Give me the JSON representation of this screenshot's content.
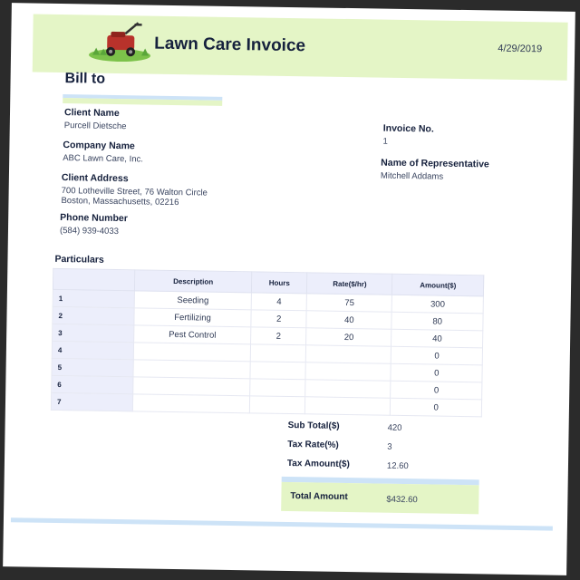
{
  "header": {
    "title": "Lawn Care Invoice",
    "date": "4/29/2019",
    "logo_icon": "lawn-mower-icon",
    "accent_green": "#e4f5c6",
    "accent_blue": "#cde3f7"
  },
  "bill_to": {
    "heading": "Bill to"
  },
  "client": {
    "name_label": "Client Name",
    "name": "Purcell Dietsche",
    "company_label": "Company Name",
    "company": "ABC Lawn Care, Inc.",
    "address_label": "Client Address",
    "address_line1": "700 Lotheville Street, 76 Walton Circle",
    "address_line2": "Boston, Massachusetts, 02216",
    "phone_label": "Phone Number",
    "phone": "(584) 939-4033"
  },
  "invoice": {
    "number_label": "Invoice No.",
    "number": "1",
    "rep_label": "Name of Representative",
    "rep": "Mitchell Addams"
  },
  "particulars": {
    "heading": "Particulars",
    "columns": [
      "",
      "Description",
      "Hours",
      "Rate($/hr)",
      "Amount($)"
    ],
    "rows": [
      {
        "idx": "1",
        "desc": "Seeding",
        "hours": "4",
        "rate": "75",
        "amount": "300"
      },
      {
        "idx": "2",
        "desc": "Fertilizing",
        "hours": "2",
        "rate": "40",
        "amount": "80"
      },
      {
        "idx": "3",
        "desc": "Pest Control",
        "hours": "2",
        "rate": "20",
        "amount": "40"
      },
      {
        "idx": "4",
        "desc": "",
        "hours": "",
        "rate": "",
        "amount": "0"
      },
      {
        "idx": "5",
        "desc": "",
        "hours": "",
        "rate": "",
        "amount": "0"
      },
      {
        "idx": "6",
        "desc": "",
        "hours": "",
        "rate": "",
        "amount": "0"
      },
      {
        "idx": "7",
        "desc": "",
        "hours": "",
        "rate": "",
        "amount": "0"
      }
    ]
  },
  "totals": {
    "subtotal_label": "Sub Total($)",
    "subtotal": "420",
    "tax_rate_label": "Tax Rate(%)",
    "tax_rate": "3",
    "tax_amount_label": "Tax Amount($)",
    "tax_amount": "12.60",
    "total_label": "Total Amount",
    "total": "$432.60"
  }
}
